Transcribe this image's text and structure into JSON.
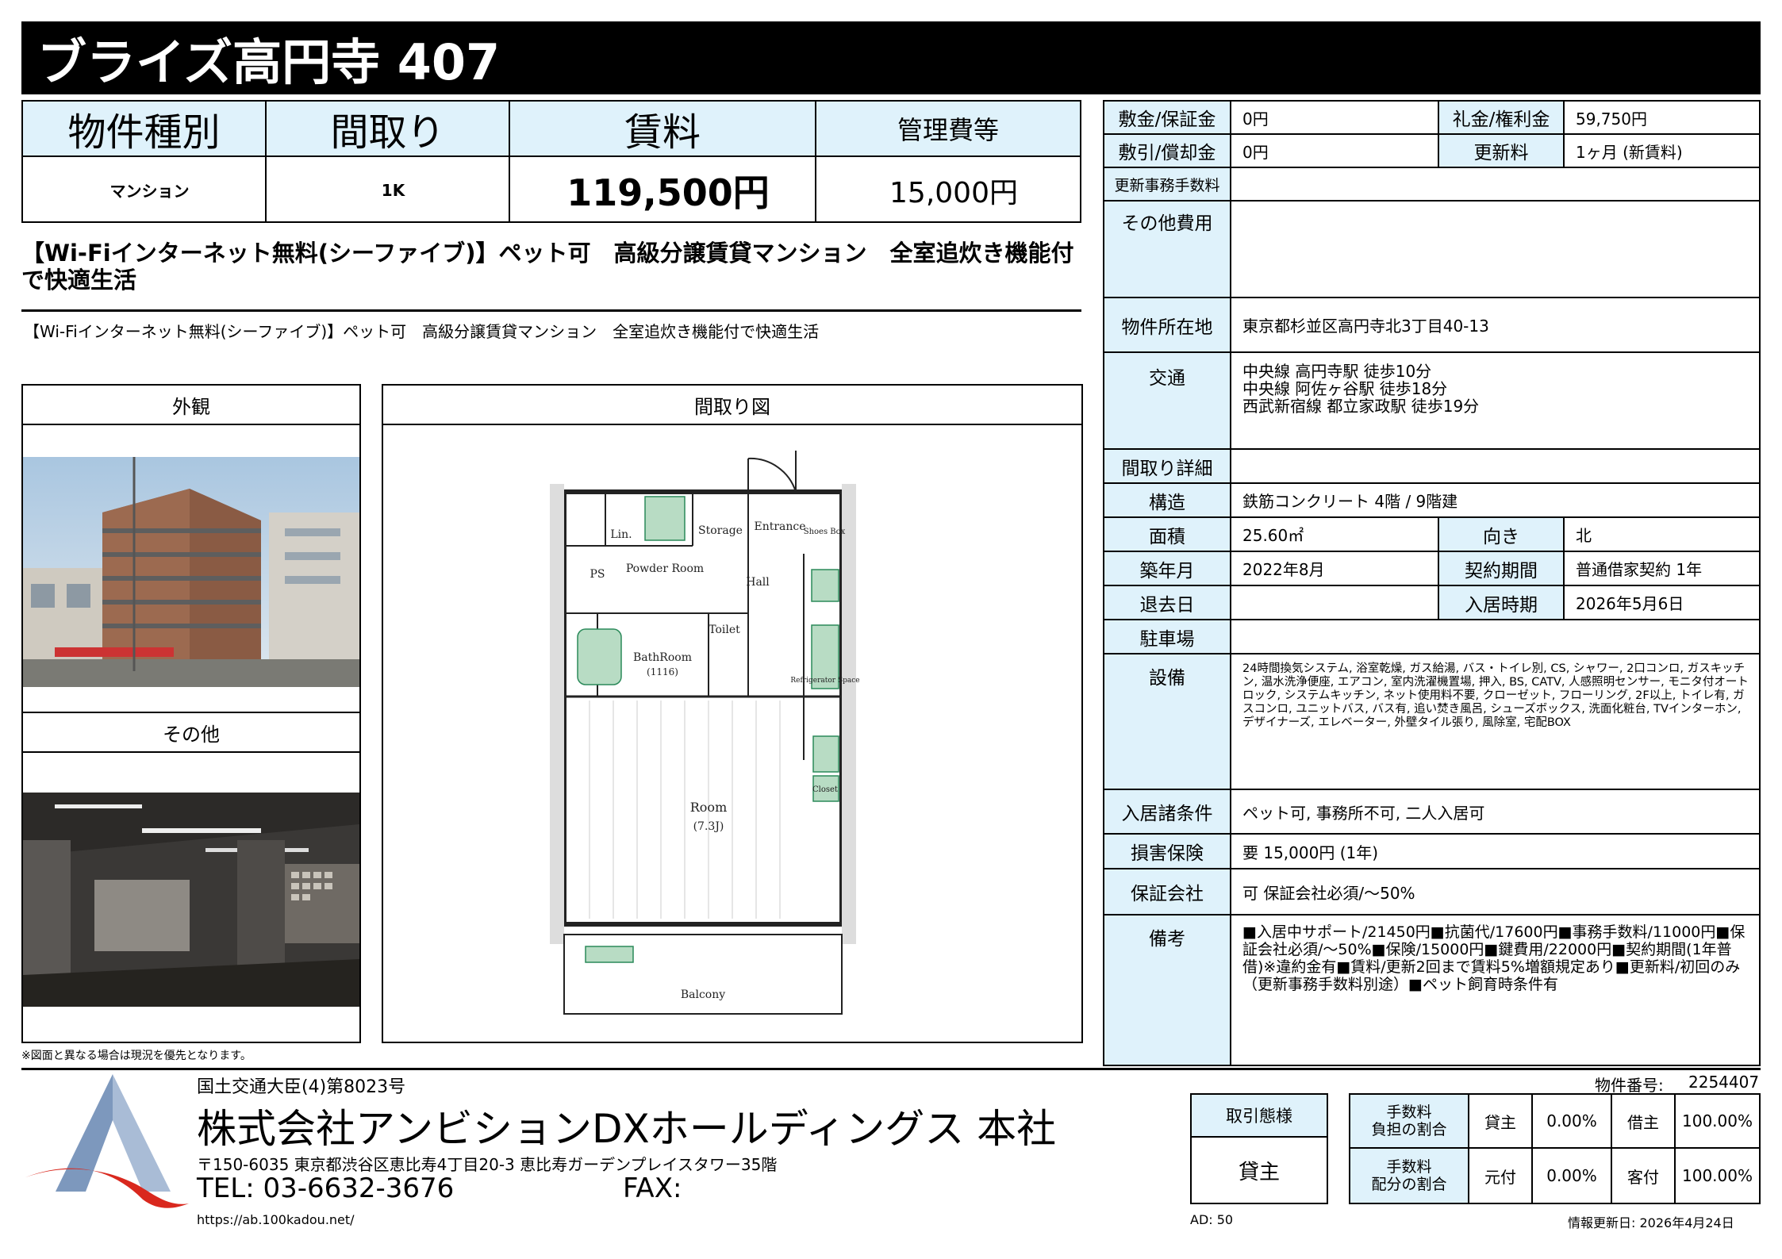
{
  "title": "ブライズ高円寺 407",
  "summary": {
    "headers": [
      "物件種別",
      "間取り",
      "賃料",
      "管理費等"
    ],
    "values": [
      "マンション",
      "1K",
      "119,500円",
      "15,000円"
    ]
  },
  "headline": "【Wi-Fiインターネット無料(シーファイブ)】ペット可　高級分譲賃貸マンション　全室追炊き機能付で快適生活",
  "subline": "【Wi-Fiインターネット無料(シーファイブ)】ペット可　高級分譲賃貸マンション　全室追炊き機能付で快適生活",
  "panels": {
    "exterior": "外観",
    "other": "その他",
    "floorplan": "間取り図"
  },
  "floorplan_labels": {
    "entrance": "Entrance",
    "storage": "Storage",
    "shoes_box": "Shoes Box",
    "lin": "Lin.",
    "ps": "PS",
    "powder_room": "Powder Room",
    "hall": "Hall",
    "toilet": "Toilet",
    "bathroom": "BathRoom",
    "bathroom_size": "(1116)",
    "refrigerator": "Refrigerator Space",
    "closet": "Closet",
    "room": "Room",
    "room_size": "(7.3J)",
    "balcony": "Balcony"
  },
  "note": "※図面と異なる場合は現況を優先となります。",
  "details": {
    "deposit_label": "敷金/保証金",
    "deposit": "0円",
    "key_money_label": "礼金/権利金",
    "key_money": "59,750円",
    "shikibiki_label": "敷引/償却金",
    "shikibiki": "0円",
    "renewal_label": "更新料",
    "renewal": "1ヶ月 (新賃料)",
    "renewal_fee_label": "更新事務手数料",
    "renewal_fee": "",
    "other_cost_label": "その他費用",
    "other_cost": "",
    "address_label": "物件所在地",
    "address": "東京都杉並区高円寺北3丁目40-13",
    "transport_label": "交通",
    "transport": [
      "中央線 高円寺駅 徒歩10分",
      "中央線 阿佐ヶ谷駅 徒歩18分",
      "西武新宿線 都立家政駅 徒歩19分"
    ],
    "layout_detail_label": "間取り詳細",
    "layout_detail": "",
    "structure_label": "構造",
    "structure": "鉄筋コンクリート 4階 / 9階建",
    "area_label": "面積",
    "area": "25.60㎡",
    "direction_label": "向き",
    "direction": "北",
    "built_label": "築年月",
    "built": "2022年8月",
    "contract_label": "契約期間",
    "contract": "普通借家契約 1年",
    "moveout_label": "退去日",
    "moveout": "",
    "movein_label": "入居時期",
    "movein": "2026年5月6日",
    "parking_label": "駐車場",
    "parking": "",
    "equipment_label": "設備",
    "equipment": "24時間換気システム, 浴室乾燥, ガス給湯, バス・トイレ別, CS, シャワー, 2口コンロ, ガスキッチン, 温水洗浄便座, エアコン, 室内洗濯機置場, 押入, BS, CATV, 人感照明センサー, モニタ付オートロック, システムキッチン, ネット使用料不要, クローゼット, フローリング, 2F以上, トイレ有, ガスコンロ, ユニットバス, バス有, 追い焚き風呂, シューズボックス, 洗面化粧台, TVインターホン, デザイナーズ, エレベーター, 外壁タイル張り, 風除室, 宅配BOX",
    "conditions_label": "入居諸条件",
    "conditions": "ペット可, 事務所不可, 二人入居可",
    "insurance_label": "損害保険",
    "insurance": "要 15,000円 (1年)",
    "guarantor_label": "保証会社",
    "guarantor": "可 保証会社必須/〜50%",
    "remarks_label": "備考",
    "remarks": "■入居中サポート/21450円■抗菌代/17600円■事務手数料/11000円■保証会社必須/〜50%■保険/15000円■鍵費用/22000円■契約期間(1年普借)※違約金有■賃料/更新2回まで賃料5%増額規定あり■更新料/初回のみ（更新事務手数料別途）■ペット飼育時条件有"
  },
  "footer": {
    "license": "国土交通大臣(4)第8023号",
    "company": "株式会社アンビションDXホールディングス 本社",
    "address": "〒150-6035 東京都渋谷区恵比寿4丁目20-3 恵比寿ガーデンプレイスタワー35階",
    "tel": "TEL: 03-6632-3676",
    "fax": "FAX:",
    "url": "https://ab.100kadou.net/",
    "property_no_label": "物件番号:",
    "property_no": "2254407",
    "deal_type_label": "取引態様",
    "deal_type": "貸主",
    "fee_burden_label": "手数料\n負担の割合",
    "fee_share_label": "手数料\n配分の割合",
    "lessor_label": "貸主",
    "lessor_pct": "0.00%",
    "lessee_label": "借主",
    "lessee_pct": "100.00%",
    "origin_label": "元付",
    "origin_pct": "0.00%",
    "agent_label": "客付",
    "agent_pct": "100.00%",
    "ad": "AD: 50",
    "updated": "情報更新日: 2026年4月24日"
  },
  "colors": {
    "header_blue": "#dff2fb",
    "logo_red": "#d9281e",
    "logo_blue": "#7d98bd"
  }
}
